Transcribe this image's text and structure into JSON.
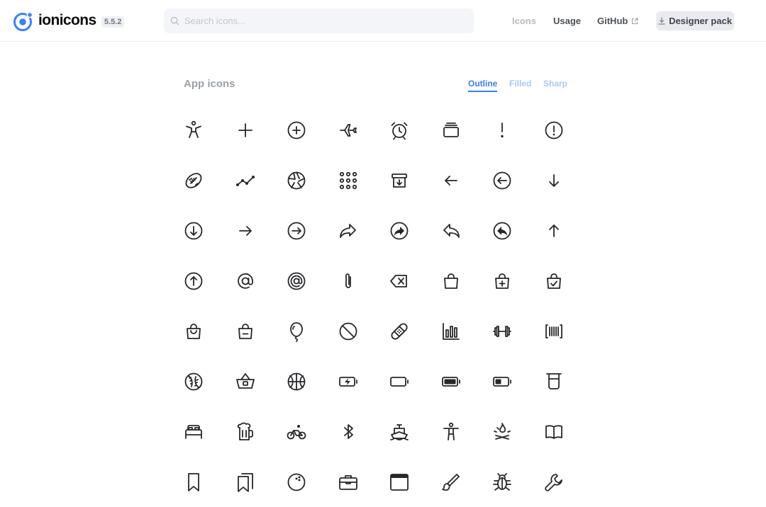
{
  "header": {
    "brand": "ionicons",
    "version": "5.5.2",
    "search_placeholder": "Search icons...",
    "nav": {
      "icons": "Icons",
      "usage": "Usage",
      "github": "GitHub"
    },
    "designer_pack": "Designer pack"
  },
  "section": {
    "title": "App icons",
    "tabs": [
      {
        "label": "Outline",
        "active": true
      },
      {
        "label": "Filled",
        "active": false
      },
      {
        "label": "Sharp",
        "active": false
      }
    ]
  },
  "icons": [
    "accessibility",
    "add",
    "add-circle",
    "airplane",
    "alarm",
    "albums",
    "alert",
    "alert-circle",
    "american-football",
    "analytics",
    "aperture",
    "apps",
    "archive",
    "arrow-back",
    "arrow-back-circle",
    "arrow-down",
    "arrow-down-circle",
    "arrow-forward",
    "arrow-forward-circle",
    "arrow-redo",
    "arrow-redo-circle",
    "arrow-undo",
    "arrow-undo-circle",
    "arrow-up",
    "arrow-up-circle",
    "at",
    "at-circle",
    "attach",
    "backspace",
    "bag",
    "bag-add",
    "bag-check",
    "bag-handle",
    "bag-remove",
    "balloon",
    "ban",
    "bandage",
    "bar-chart",
    "barbell",
    "barcode",
    "baseball",
    "basket",
    "basketball",
    "battery-charging",
    "battery-dead",
    "battery-full",
    "battery-half",
    "beaker",
    "bed",
    "beer",
    "bicycle",
    "bluetooth",
    "boat",
    "body",
    "bonfire",
    "book",
    "bookmark",
    "bookmarks",
    "bowling-ball",
    "briefcase",
    "browsers",
    "brush",
    "bug",
    "build"
  ],
  "colors": {
    "accent": "#3880e6",
    "icon": "#26282b",
    "muted": "#9ba1aa"
  }
}
